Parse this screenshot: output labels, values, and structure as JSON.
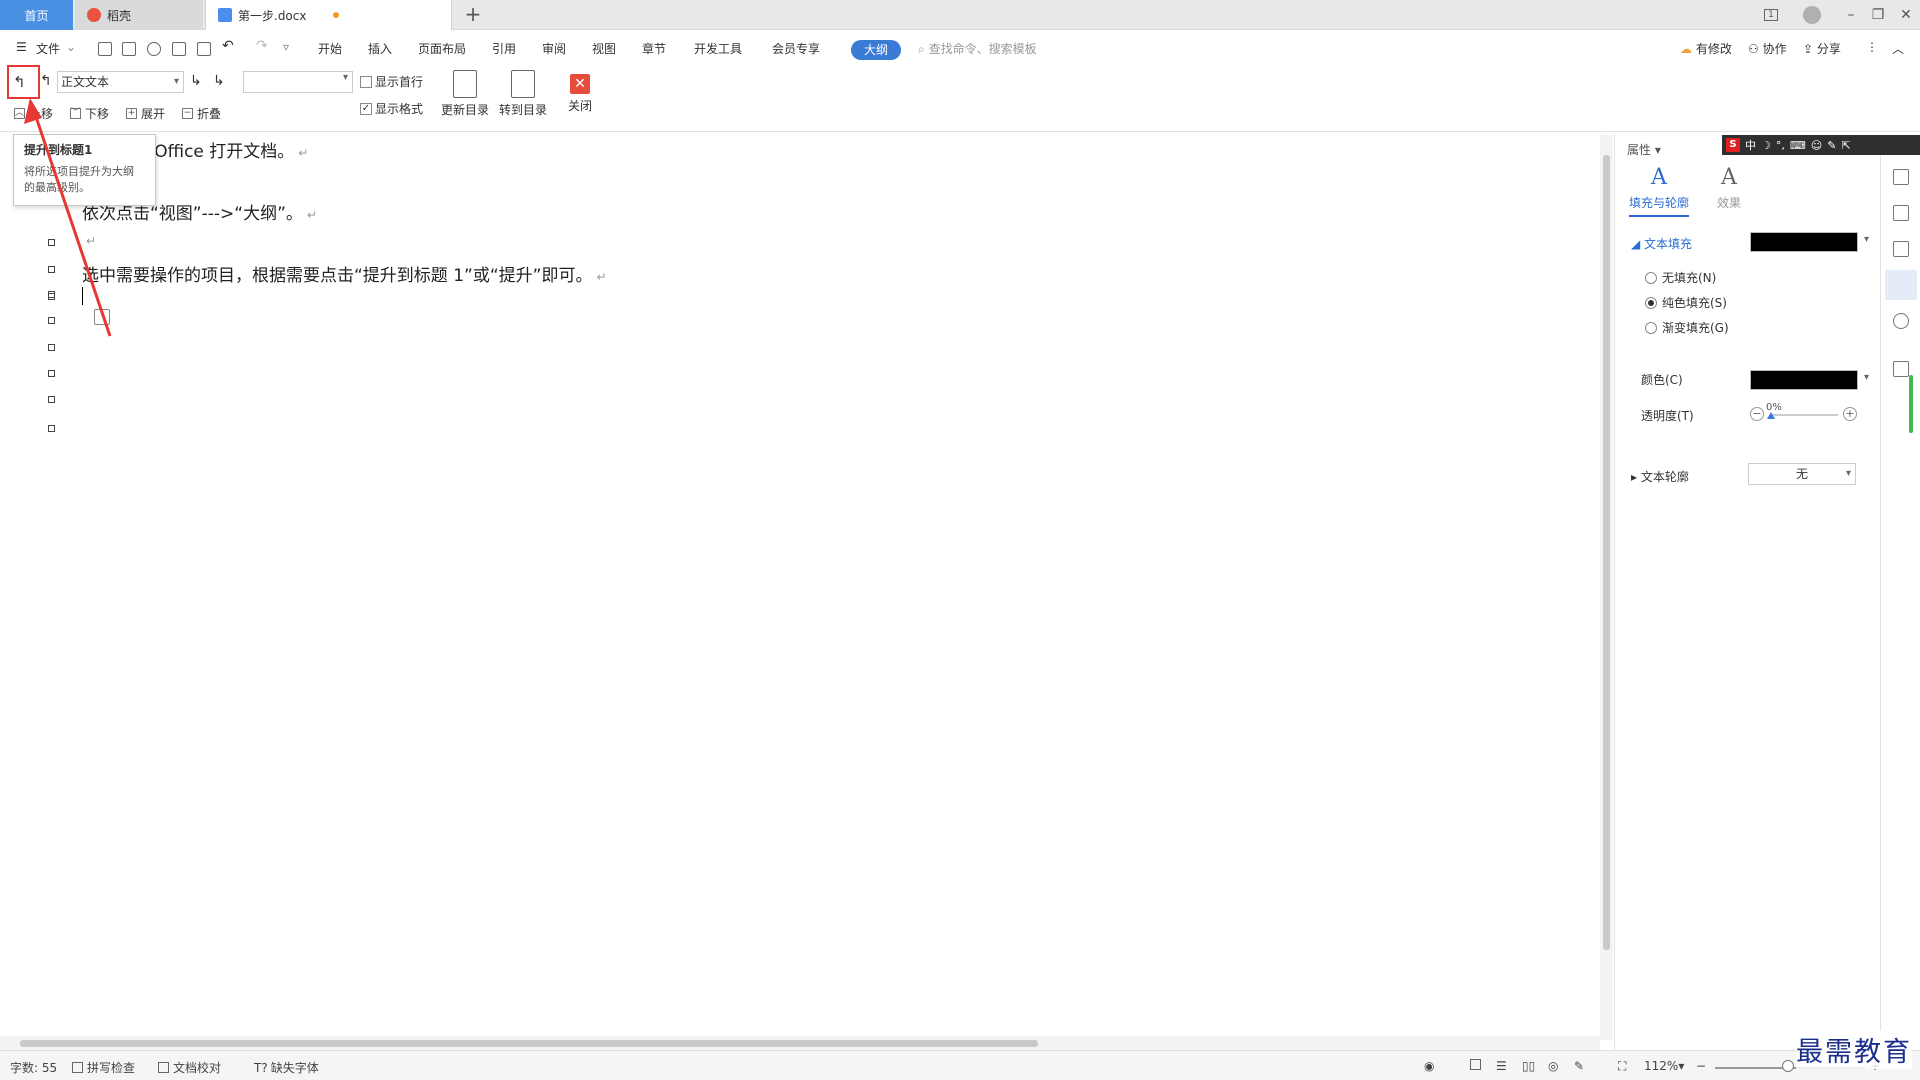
{
  "tabs": {
    "home": "首页",
    "daoke": "稻壳",
    "document": "第一步.docx",
    "add": "+"
  },
  "window": {
    "page_indicator": "1",
    "minimize": "–",
    "restore": "❐",
    "close": "✕"
  },
  "menu": {
    "file": "文件",
    "items": [
      "开始",
      "插入",
      "页面布局",
      "引用",
      "审阅",
      "视图",
      "章节",
      "开发工具",
      "会员专享"
    ],
    "active": "大纲",
    "search_placeholder": "查找命令、搜索模板",
    "right": {
      "changes": "有修改",
      "collaborate": "协作",
      "share": "分享"
    }
  },
  "outline_toolbar": {
    "style_select": "正文文本",
    "move_up": "上移",
    "move_down": "下移",
    "expand": "展开",
    "collapse": "折叠",
    "show_first_line": "显示首行",
    "show_format": "显示格式",
    "show_first_line_checked": false,
    "show_format_checked": true,
    "update_toc": "更新目录",
    "goto_toc": "转到目录",
    "close": "关闭"
  },
  "tooltip": {
    "title": "提升到标题1",
    "description_line1": "将所选项目提升为大纲",
    "description_line2": "的最高级别。"
  },
  "document": {
    "paragraphs": [
      "s·Office 打开文档。",
      "依次点击“视图”--->“大纲”。",
      "选中需要操作的项目，根据需要点击“提升到标题 1”或“提升”即可。"
    ],
    "para_mark": "↵"
  },
  "panel": {
    "title": "属性",
    "tab_fill": "填充与轮廓",
    "tab_effect": "效果",
    "text_fill": "文本填充",
    "fill_options": [
      "无填充(N)",
      "纯色填充(S)",
      "渐变填充(G)"
    ],
    "fill_selected": 1,
    "color_label": "颜色(C)",
    "transparency_label": "透明度(T)",
    "transparency_value": "0%",
    "text_outline": "文本轮廓",
    "outline_value": "无",
    "fill_color": "#000000"
  },
  "ime": {
    "logo": "S",
    "mode": "中"
  },
  "status": {
    "word_count": "字数: 55",
    "spell_check": "拼写检查",
    "doc_proof": "文档校对",
    "missing_font": "缺失字体",
    "zoom": "112%"
  },
  "watermark": "最需教育",
  "colors": {
    "accent": "#3a7bd5",
    "highlight": "#e53935"
  }
}
